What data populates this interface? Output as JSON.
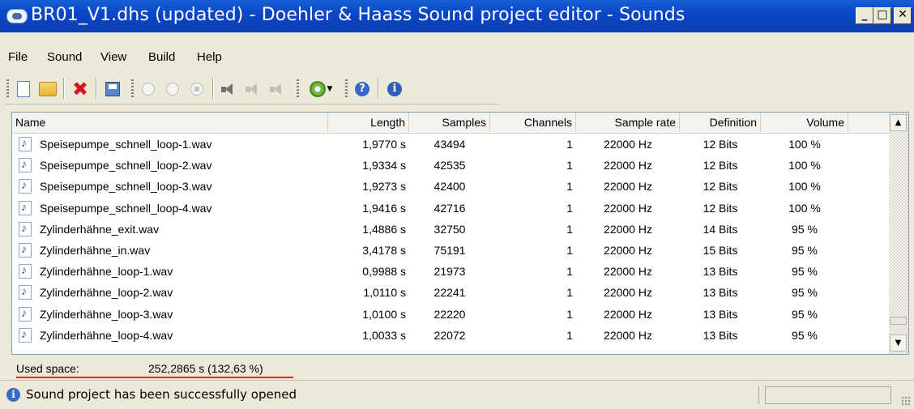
{
  "window": {
    "title": "BR01_V1.dhs (updated) - Doehler & Haass Sound project editor - Sounds",
    "controls": [
      "minimize",
      "maximize",
      "close"
    ]
  },
  "menu": [
    "File",
    "Sound",
    "View",
    "Build",
    "Help"
  ],
  "toolbar": {
    "buttons": [
      "new-icon",
      "open-icon",
      "delete-icon",
      "save-icon",
      "play-icon",
      "loop-icon",
      "stop-icon",
      "speaker-icon",
      "speaker-dim-icon",
      "speaker-dim-2-icon",
      "gear-icon",
      "help-icon",
      "info-icon"
    ]
  },
  "list": {
    "columns": [
      "Name",
      "Length",
      "Samples",
      "Channels",
      "Sample rate",
      "Definition",
      "Volume"
    ],
    "rows": [
      {
        "name": "Speisepumpe_schnell_loop-1.wav",
        "length": "1,9770 s",
        "samples": "43494",
        "channels": "1",
        "rate": "22000 Hz",
        "definition": "12 Bits",
        "volume": "100 %"
      },
      {
        "name": "Speisepumpe_schnell_loop-2.wav",
        "length": "1,9334 s",
        "samples": "42535",
        "channels": "1",
        "rate": "22000 Hz",
        "definition": "12 Bits",
        "volume": "100 %"
      },
      {
        "name": "Speisepumpe_schnell_loop-3.wav",
        "length": "1,9273 s",
        "samples": "42400",
        "channels": "1",
        "rate": "22000 Hz",
        "definition": "12 Bits",
        "volume": "100 %"
      },
      {
        "name": "Speisepumpe_schnell_loop-4.wav",
        "length": "1,9416 s",
        "samples": "42716",
        "channels": "1",
        "rate": "22000 Hz",
        "definition": "12 Bits",
        "volume": "100 %"
      },
      {
        "name": "Zylinderhähne_exit.wav",
        "length": "1,4886 s",
        "samples": "32750",
        "channels": "1",
        "rate": "22000 Hz",
        "definition": "14 Bits",
        "volume": "95 %"
      },
      {
        "name": "Zylinderhähne_in.wav",
        "length": "3,4178 s",
        "samples": "75191",
        "channels": "1",
        "rate": "22000 Hz",
        "definition": "15 Bits",
        "volume": "95 %"
      },
      {
        "name": "Zylinderhähne_loop-1.wav",
        "length": "0,9988 s",
        "samples": "21973",
        "channels": "1",
        "rate": "22000 Hz",
        "definition": "13 Bits",
        "volume": "95 %"
      },
      {
        "name": "Zylinderhähne_loop-2.wav",
        "length": "1,0110 s",
        "samples": "22241",
        "channels": "1",
        "rate": "22000 Hz",
        "definition": "13 Bits",
        "volume": "95 %"
      },
      {
        "name": "Zylinderhähne_loop-3.wav",
        "length": "1,0100 s",
        "samples": "22220",
        "channels": "1",
        "rate": "22000 Hz",
        "definition": "13 Bits",
        "volume": "95 %"
      },
      {
        "name": "Zylinderhähne_loop-4.wav",
        "length": "1,0033 s",
        "samples": "22072",
        "channels": "1",
        "rate": "22000 Hz",
        "definition": "13 Bits",
        "volume": "95 %"
      }
    ]
  },
  "used_space": {
    "label": "Used space:",
    "value": "252,2865 s (132,63 %)",
    "underline_color": "#e0262b"
  },
  "status": {
    "message": "Sound project has been successfully opened"
  }
}
